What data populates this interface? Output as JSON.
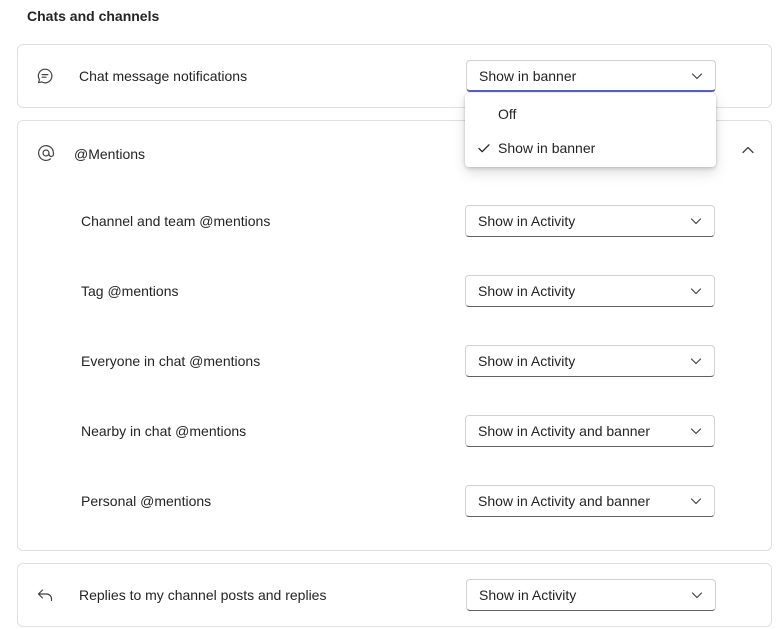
{
  "section": {
    "title": "Chats and channels"
  },
  "chat": {
    "icon": "chat-bubble-icon",
    "label": "Chat message notifications",
    "value": "Show in banner"
  },
  "menu": {
    "options": [
      {
        "label": "Off",
        "selected": false
      },
      {
        "label": "Show in banner",
        "selected": true
      }
    ]
  },
  "mentions": {
    "icon": "at-sign-icon",
    "label": "@Mentions",
    "items": [
      {
        "label": "Channel and team @mentions",
        "value": "Show in Activity"
      },
      {
        "label": "Tag @mentions",
        "value": "Show in Activity"
      },
      {
        "label": "Everyone in chat @mentions",
        "value": "Show in Activity"
      },
      {
        "label": "Nearby in chat @mentions",
        "value": "Show in Activity and banner"
      },
      {
        "label": "Personal @mentions",
        "value": "Show in Activity and banner"
      }
    ]
  },
  "replies": {
    "icon": "reply-arrow-icon",
    "label": "Replies to my channel posts and replies",
    "value": "Show in Activity"
  },
  "colors": {
    "accent": "#5b5fc7",
    "border": "#e0e0e0",
    "text": "#242424"
  }
}
